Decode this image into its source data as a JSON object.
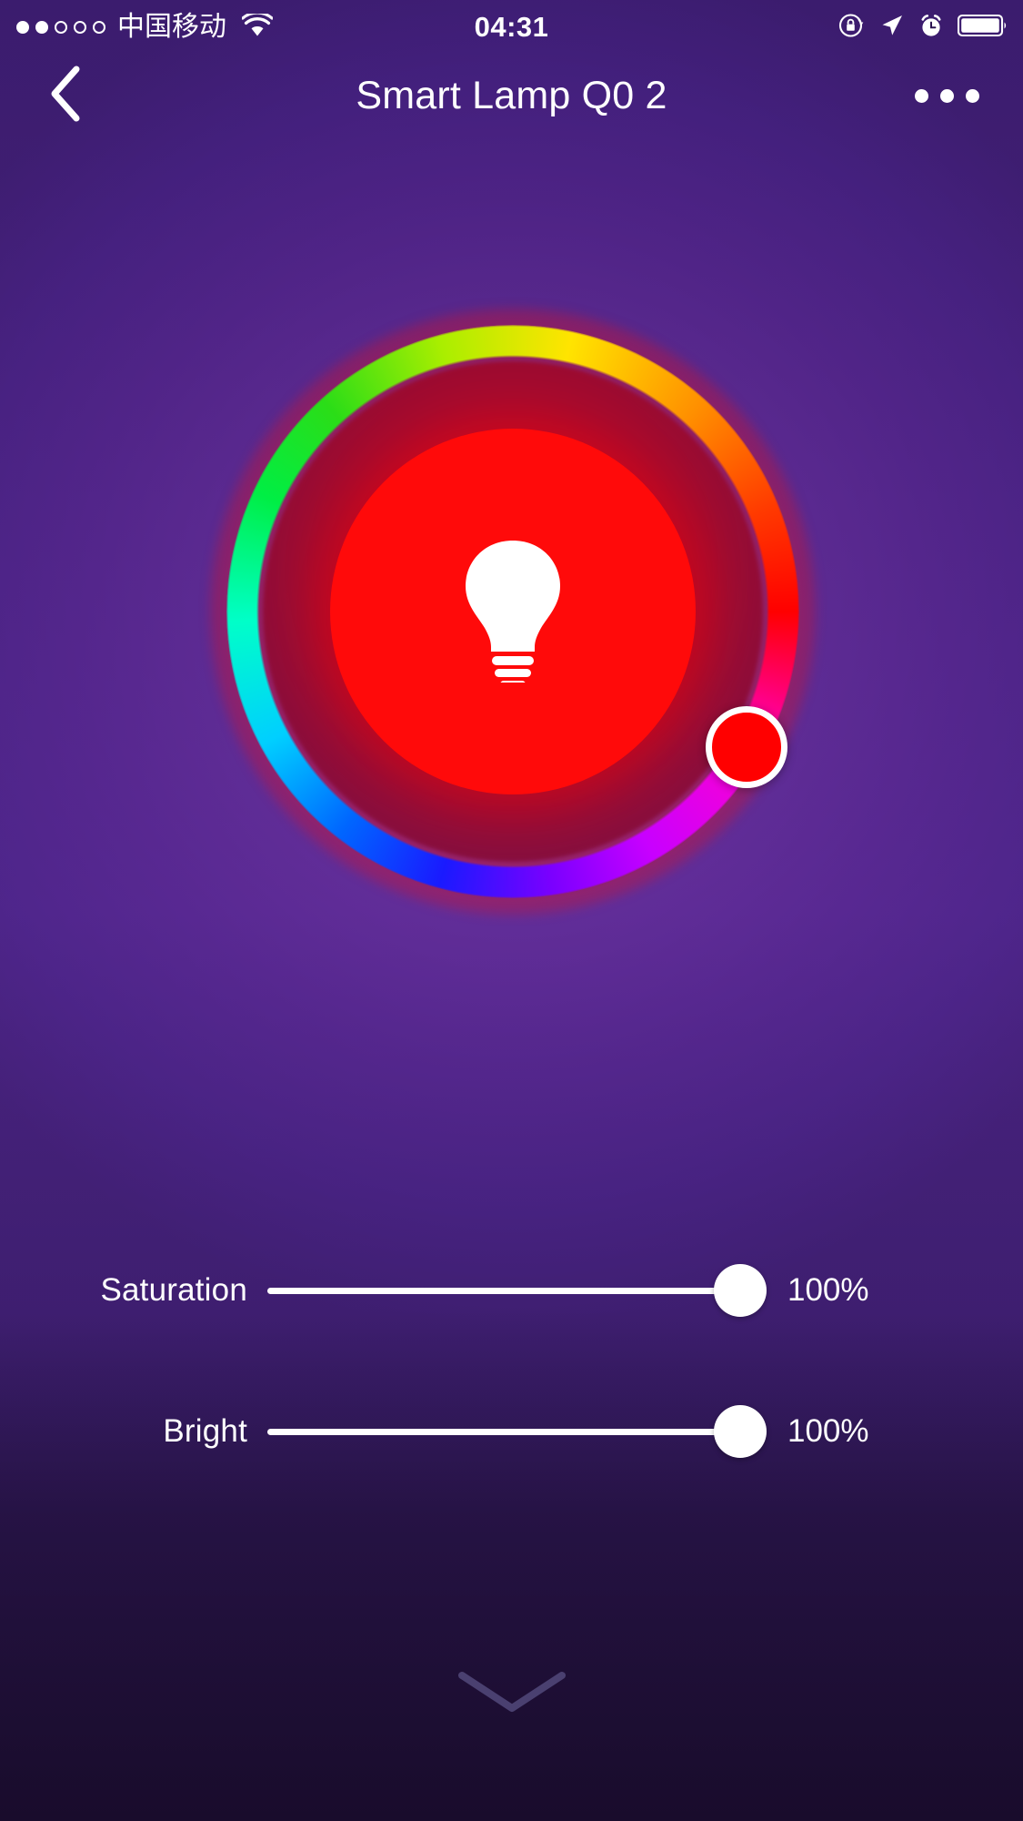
{
  "status_bar": {
    "signal_dots_filled": 2,
    "signal_dots_total": 5,
    "carrier": "中国移动",
    "wifi_icon": "wifi-icon",
    "time": "04:31",
    "right_icons": [
      "rotation-lock-icon",
      "location-arrow-icon",
      "alarm-clock-icon",
      "battery-icon"
    ],
    "battery_full": true
  },
  "nav_bar": {
    "back_icon": "chevron-left-icon",
    "title": "Smart Lamp Q0 2",
    "more_icon": "more-options-icon"
  },
  "color_wheel": {
    "name": "hue-color-wheel",
    "selected_color": "#FF0000",
    "selected_hue_deg": 0,
    "handle_angle_deg": 30,
    "power_icon": "light-bulb-icon",
    "power_state": "on",
    "inner_disc_color": "#FF0A0A",
    "hue_stops": [
      "#ff0000",
      "#ff9000",
      "#ffe400",
      "#2bdd17",
      "#00ffc8",
      "#00cfff",
      "#1a1aff",
      "#7a00ff",
      "#ff00d0"
    ]
  },
  "sliders": [
    {
      "name": "saturation",
      "label": "Saturation",
      "value": 100,
      "value_text": "100%",
      "percent": 100
    },
    {
      "name": "bright",
      "label": "Bright",
      "value": 100,
      "value_text": "100%",
      "percent": 100
    }
  ],
  "footer": {
    "collapse_icon": "chevron-down-icon"
  },
  "colors": {
    "background_top": "#241049",
    "background_mid": "#3c1a5e",
    "background_bottom": "#190c2c",
    "accent": "#FF0000",
    "text": "#FFFFFF",
    "chevron_muted": "#4a4070"
  }
}
